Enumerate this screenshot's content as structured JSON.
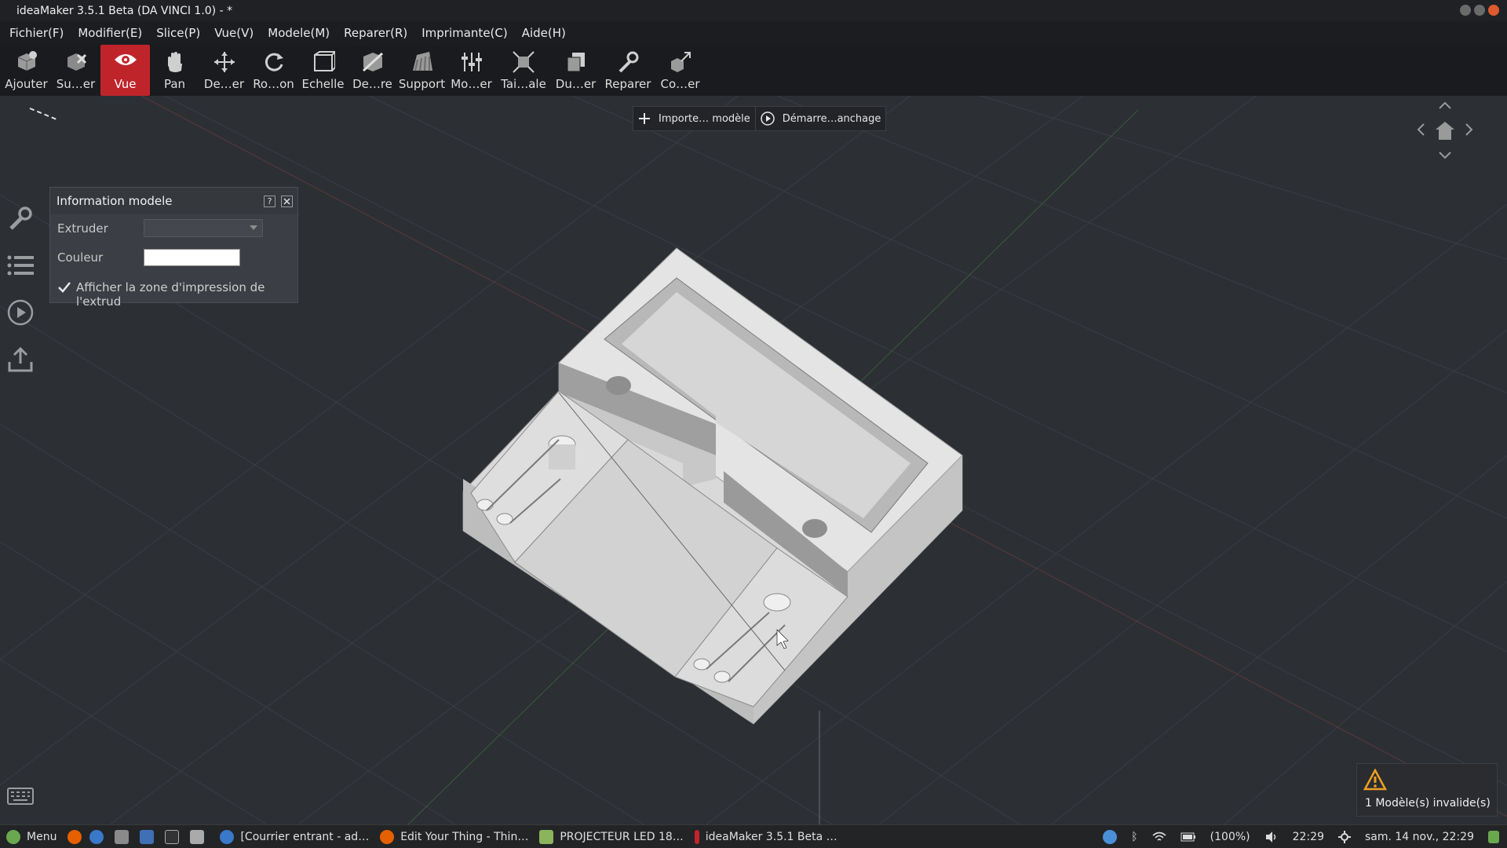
{
  "window": {
    "title": "ideaMaker 3.5.1 Beta (DA VINCI 1.0) - *"
  },
  "menu": [
    "Fichier(F)",
    "Modifier(E)",
    "Slice(P)",
    "Vue(V)",
    "Modele(M)",
    "Reparer(R)",
    "Imprimante(C)",
    "Aide(H)"
  ],
  "toolbar": [
    {
      "label": "Ajouter",
      "icon": "add-model-icon"
    },
    {
      "label": "Su…er",
      "icon": "delete-model-icon"
    },
    {
      "label": "Vue",
      "icon": "eye-icon",
      "active": true
    },
    {
      "label": "Pan",
      "icon": "hand-icon"
    },
    {
      "label": "De…er",
      "icon": "move-icon"
    },
    {
      "label": "Ro…on",
      "icon": "rotate-icon"
    },
    {
      "label": "Echelle",
      "icon": "scale-icon"
    },
    {
      "label": "De…re",
      "icon": "cut-icon"
    },
    {
      "label": "Support",
      "icon": "support-icon"
    },
    {
      "label": "Mo…er",
      "icon": "modifier-icon"
    },
    {
      "label": "Tai…ale",
      "icon": "fit-size-icon"
    },
    {
      "label": "Du…er",
      "icon": "duplicate-icon"
    },
    {
      "label": "Reparer",
      "icon": "wrench-icon"
    },
    {
      "label": "Co…er",
      "icon": "export-icon"
    }
  ],
  "viewport_buttons": {
    "import": "Importe… modèle",
    "start": "Démarre…anchage"
  },
  "info_panel": {
    "title": "Information modele",
    "help": "?",
    "extruder_label": "Extruder",
    "extruder_value": "",
    "color_label": "Couleur",
    "show_zone_label": "Afficher la zone d'impression de l'extrud",
    "show_zone_checked": true
  },
  "warning": {
    "text": "1 Modèle(s) invalide(s)"
  },
  "taskbar": {
    "menu_label": "Menu",
    "windows": [
      "[Courrier entrant - ad…",
      "Edit Your Thing - Thin…",
      "PROJECTEUR LED 18…",
      "ideaMaker 3.5.1 Beta …"
    ],
    "battery": "(100%)",
    "time": "22:29",
    "datetime": "sam. 14 nov., 22:29"
  },
  "colors": {
    "accent": "#c0242b",
    "viewport_bg": "#2c2f34",
    "toolbar_bg": "#1a1b1e"
  }
}
